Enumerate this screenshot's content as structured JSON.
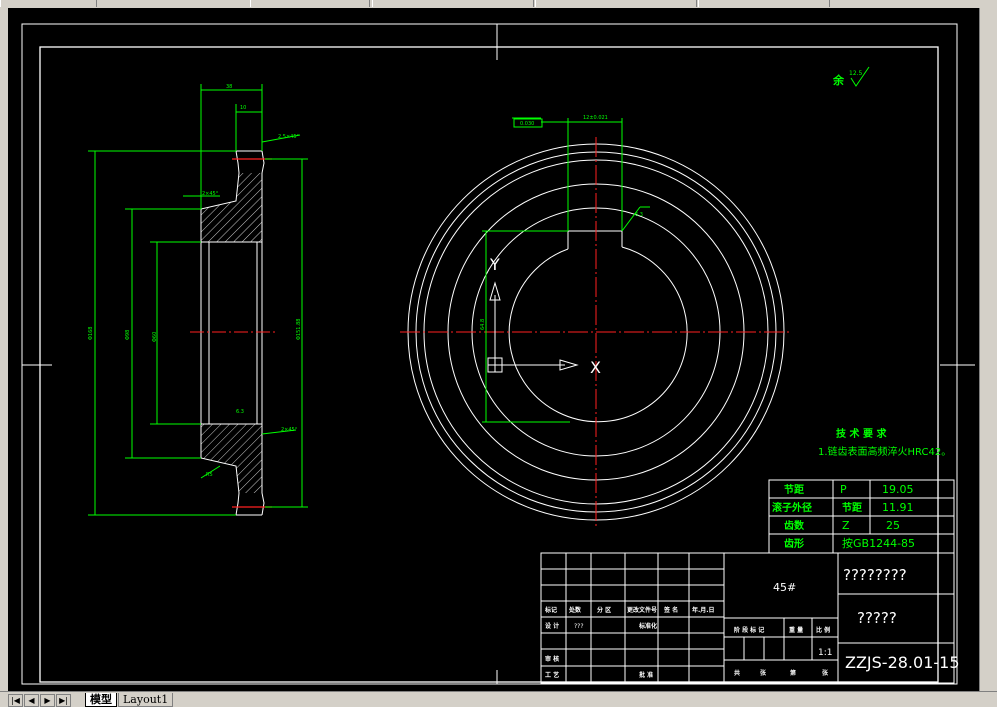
{
  "tabs": {
    "model": "模型",
    "layout1": "Layout1"
  },
  "nav_icons": [
    "first-icon",
    "prev-icon",
    "next-icon",
    "last-icon"
  ],
  "drawing": {
    "roughness_note": "余",
    "roughness_value": "12.5",
    "tech_title": "技 术 要 求",
    "tech_item": "1.链齿表面高频淬火HRC42。",
    "key_tol": "0.030",
    "key_width": "12±0.021",
    "ucs_x": "X",
    "ucs_y": "Y",
    "param_table": [
      [
        "节距",
        "P",
        "19.05"
      ],
      [
        "滚子外径",
        "节距",
        "11.91"
      ],
      [
        "齿数",
        "Z",
        "25"
      ],
      [
        "齿形",
        "按GB1244-85",
        ""
      ]
    ],
    "title_block": {
      "material": "45#",
      "name1": "????????",
      "name2": "?????",
      "drawing_no": "ZZJS-28.01-15",
      "scale": "1:1",
      "row_labels": [
        "标记",
        "处数",
        "分 区",
        "更改文件号",
        "签 名",
        "年.月.日"
      ],
      "design": "设 计",
      "check": "审 核",
      "process": "工 艺",
      "std": "标准化",
      "approve": "批 准",
      "stage": "阶 段 标 记",
      "weight": "重 量",
      "ratio": "比 例",
      "sheet_a": "共",
      "sheet_b": "张",
      "sheet_c": "第",
      "sheet_d": "张"
    }
  }
}
